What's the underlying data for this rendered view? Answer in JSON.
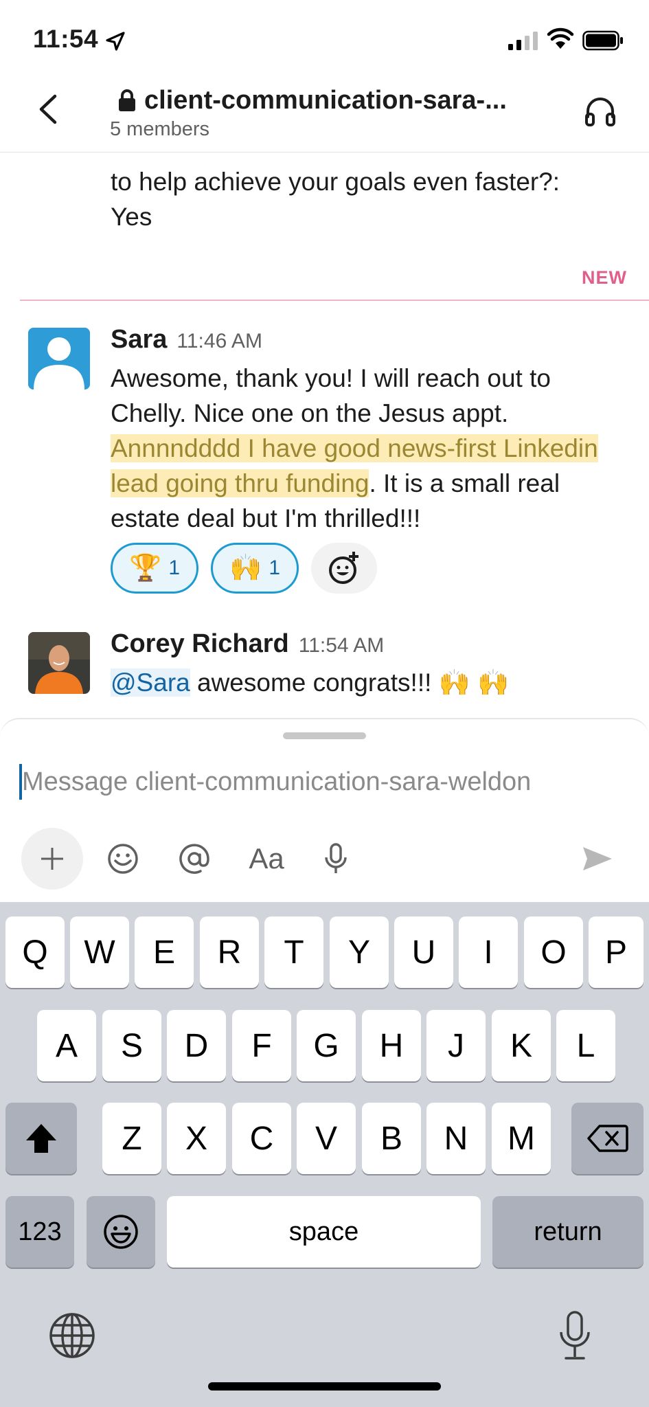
{
  "status_bar": {
    "time": "11:54"
  },
  "header": {
    "channel_name": "client-communication-sara-...",
    "members": "5 members"
  },
  "messages": {
    "previous_text_line1": "to help achieve your goals even faster?:",
    "previous_text_line2": "Yes",
    "new_label": "NEW",
    "sara": {
      "sender": "Sara",
      "time": "11:46 AM",
      "text_part1": "Awesome, thank you! I will reach out to Chelly. Nice one on the Jesus appt. ",
      "text_highlight": "Annnndddd I have good news-first Linkedin lead going thru funding",
      "text_part2": ". It is a small real estate deal but I'm thrilled!!!",
      "reactions": [
        {
          "emoji": "🏆",
          "count": "1"
        },
        {
          "emoji": "🙌",
          "count": "1"
        }
      ]
    },
    "corey": {
      "sender": "Corey Richard",
      "time": "11:54 AM",
      "mention": "@Sara",
      "text": " awesome congrats!!! 🙌 🙌"
    }
  },
  "composer": {
    "placeholder": "Message client-communication-sara-weldon",
    "format_label": "Aa"
  },
  "keyboard": {
    "row1": [
      "Q",
      "W",
      "E",
      "R",
      "T",
      "Y",
      "U",
      "I",
      "O",
      "P"
    ],
    "row2": [
      "A",
      "S",
      "D",
      "F",
      "G",
      "H",
      "J",
      "K",
      "L"
    ],
    "row3": [
      "Z",
      "X",
      "C",
      "V",
      "B",
      "N",
      "M"
    ],
    "numbers_label": "123",
    "space_label": "space",
    "return_label": "return"
  },
  "colors": {
    "new_marker": "#e0608b",
    "highlight_bg": "#fdecb6",
    "mention": "#1264a3",
    "reaction_border": "#1d9bd1"
  }
}
